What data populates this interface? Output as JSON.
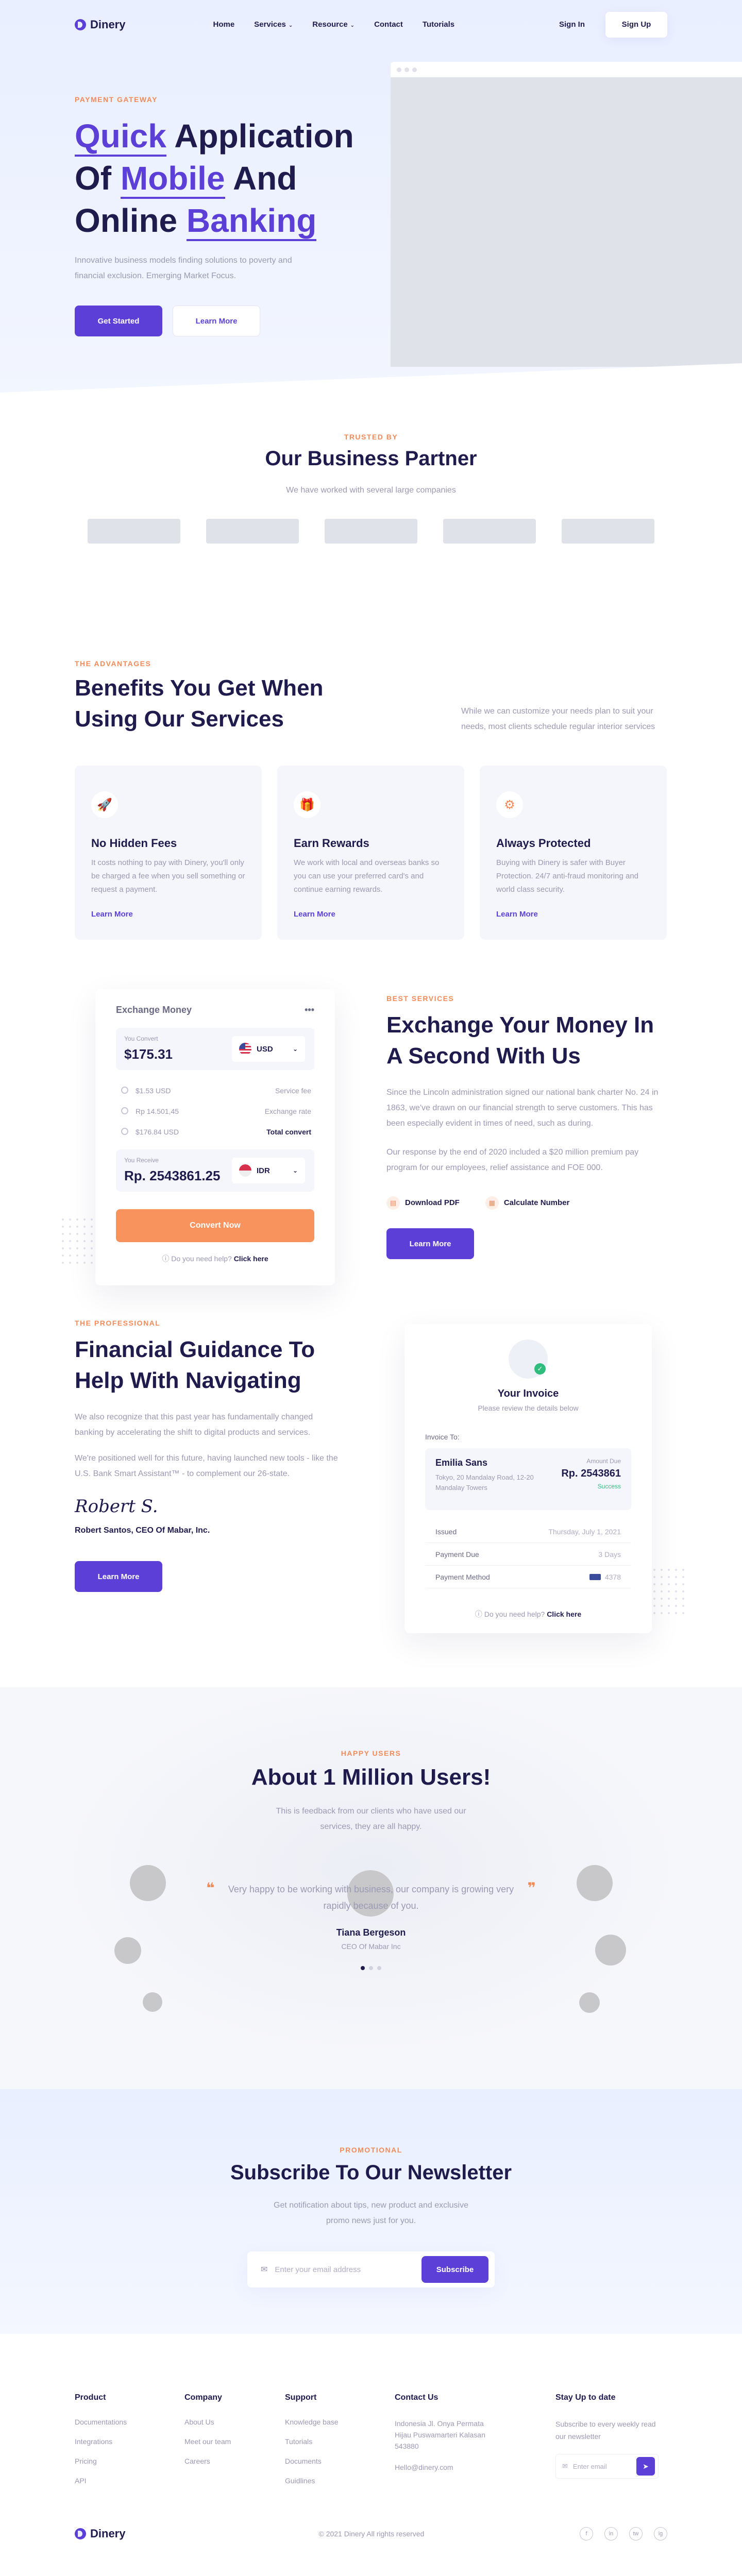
{
  "nav": {
    "brand": "Dinery",
    "links": [
      "Home",
      "Services",
      "Resource",
      "Contact",
      "Tutorials"
    ],
    "signin": "Sign In",
    "signup": "Sign Up"
  },
  "hero": {
    "eyebrow": "PAYMENT GATEWAY",
    "t1a": "Quick",
    "t1b": " Application",
    "t2a": "Of ",
    "t2b": "Mobile",
    "t2c": " And",
    "t3a": "Online ",
    "t3b": "Banking",
    "sub": "Innovative business models finding solutions to poverty and financial exclusion. Emerging Market Focus.",
    "cta_primary": "Get Started",
    "cta_secondary": "Learn More"
  },
  "partners": {
    "eyebrow": "TRUSTED BY",
    "title": "Our Business Partner",
    "sub": "We have worked with several large companies"
  },
  "advantages": {
    "eyebrow": "THE ADVANTAGES",
    "title": "Benefits You Get When Using Our Services",
    "desc": "While we can customize your needs plan to suit your needs, most clients schedule regular interior services",
    "cards": [
      {
        "icon": "rocket-icon",
        "title": "No Hidden Fees",
        "text": "It costs nothing to pay with Dinery, you'll only be charged a fee when you sell something or request a payment.",
        "link": "Learn More"
      },
      {
        "icon": "gift-icon",
        "title": "Earn Rewards",
        "text": "We work with local and overseas banks so you can use your preferred card's and continue earning rewards.",
        "link": "Learn More"
      },
      {
        "icon": "shield-icon",
        "title": "Always Protected",
        "text": "Buying with Dinery is safer with Buyer Protection. 24/7 anti-fraud monitoring and world class security.",
        "link": "Learn More"
      }
    ]
  },
  "exchange": {
    "card_title": "Exchange Money",
    "convert_label": "You Convert",
    "convert_value": "$175.31",
    "convert_currency": "USD",
    "rows": [
      {
        "k": "$1.53 USD",
        "v": "Service fee"
      },
      {
        "k": "Rp 14.501,45",
        "v": "Exchange rate"
      },
      {
        "k": "$176.84 USD",
        "v": "Total convert"
      }
    ],
    "receive_label": "You Receive",
    "receive_value": "Rp. 2543861.25",
    "receive_currency": "IDR",
    "convert_btn": "Convert Now",
    "help": "Do you need help?",
    "help_link": "Click here",
    "eyebrow": "BEST SERVICES",
    "title": "Exchange Your Money In A Second With Us",
    "p1": "Since the Lincoln administration signed our national bank charter No. 24 in 1863, we've drawn on our financial strength to serve customers. This has been especially evident in times of need, such as during.",
    "p2": "Our response by the end of 2020 included a $20 million premium pay program for our employees, relief assistance and FOE 000.",
    "link1": "Download PDF",
    "link2": "Calculate Number",
    "cta": "Learn More"
  },
  "guidance": {
    "eyebrow": "THE PROFESSIONAL",
    "title": "Financial Guidance To Help With Navigating",
    "p1": "We also recognize that this past year has fundamentally changed banking by accelerating the shift to digital products and services.",
    "p2": "We're positioned well for this future, having launched new tools - like the U.S. Bank Smart Assistant™ - to complement our 26-state.",
    "signature": "Robert S.",
    "name": "Robert Santos, CEO Of Mabar, Inc.",
    "cta": "Learn More"
  },
  "invoice": {
    "title": "Your Invoice",
    "sub": "Please review the details below",
    "to": "Invoice To:",
    "client": "Emilia Sans",
    "address": "Tokyo, 20 Mandalay Road, 12-20 Mandalay Towers",
    "amount_label": "Amount Due",
    "amount": "Rp. 2543861",
    "status": "Success",
    "rows": [
      {
        "k": "Issued",
        "v": "Thursday, July 1, 2021"
      },
      {
        "k": "Payment Due",
        "v": "3 Days"
      },
      {
        "k": "Payment Method",
        "v": "4378"
      }
    ],
    "help": "Do you need help?",
    "help_link": "Click here"
  },
  "users": {
    "eyebrow": "HAPPY USERS",
    "title": "About 1 Million Users!",
    "lead": "This is feedback from our clients who have used our services, they are all happy.",
    "quote": "Very happy to be working with business, our company is growing very rapidly because of you.",
    "name": "Tiana Bergeson",
    "role": "CEO Of Mabar Inc"
  },
  "newsletter": {
    "eyebrow": "PROMOTIONAL",
    "title": "Subscribe To Our Newsletter",
    "lead": "Get notification about tips, new product and exclusive promo news just for you.",
    "placeholder": "Enter your email address",
    "btn": "Subscribe"
  },
  "footer": {
    "product": {
      "title": "Product",
      "items": [
        "Documentations",
        "Integrations",
        "Pricing",
        "API"
      ]
    },
    "company": {
      "title": "Company",
      "items": [
        "About Us",
        "Meet our team",
        "Careers"
      ]
    },
    "support": {
      "title": "Support",
      "items": [
        "Knowledge base",
        "Tutorials",
        "Documents",
        "Guidlines"
      ]
    },
    "contact": {
      "title": "Contact Us",
      "items": [
        "Indonesia Jl. Onya Permata Hijau Puswamarteri Kalasan 543880",
        "Hello@dinery.com"
      ]
    },
    "stay": {
      "title": "Stay Up to date",
      "text": "Subscribe to every weekly read our newsletter",
      "placeholder": "Enter email"
    },
    "brand": "Dinery",
    "copyright": "© 2021 Dinery All rights reserved",
    "social": [
      "f",
      "in",
      "tw",
      "ig"
    ]
  }
}
